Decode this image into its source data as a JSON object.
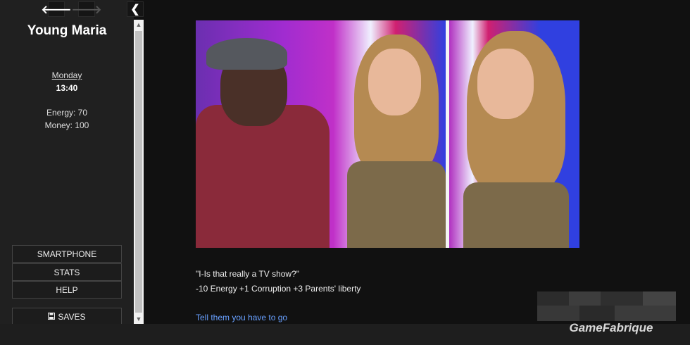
{
  "sidebar": {
    "nav": {
      "back_icon": "arrow-left-icon",
      "forward_icon": "arrow-right-icon",
      "stow_icon": "chevron-left-icon"
    },
    "story_title": "Young Maria",
    "day": "Monday",
    "time": "13:40",
    "energy": "Energy: 70",
    "money": "Money: 100",
    "menu": {
      "smartphone": "SMARTPHONE",
      "stats": "STATS",
      "help": "HELP",
      "saves": "SAVES",
      "saves_icon": "floppy-disk-icon"
    }
  },
  "passage": {
    "dialogue": "\"I-Is that really a TV show?\"",
    "effects": "-10 Energy +1 Corruption +3 Parents' liberty",
    "choice": "Tell them you have to go"
  },
  "watermark": {
    "text": "GameFabrique"
  },
  "colors": {
    "background": "#111111",
    "sidebar": "#202020",
    "link": "#68a0ff"
  }
}
